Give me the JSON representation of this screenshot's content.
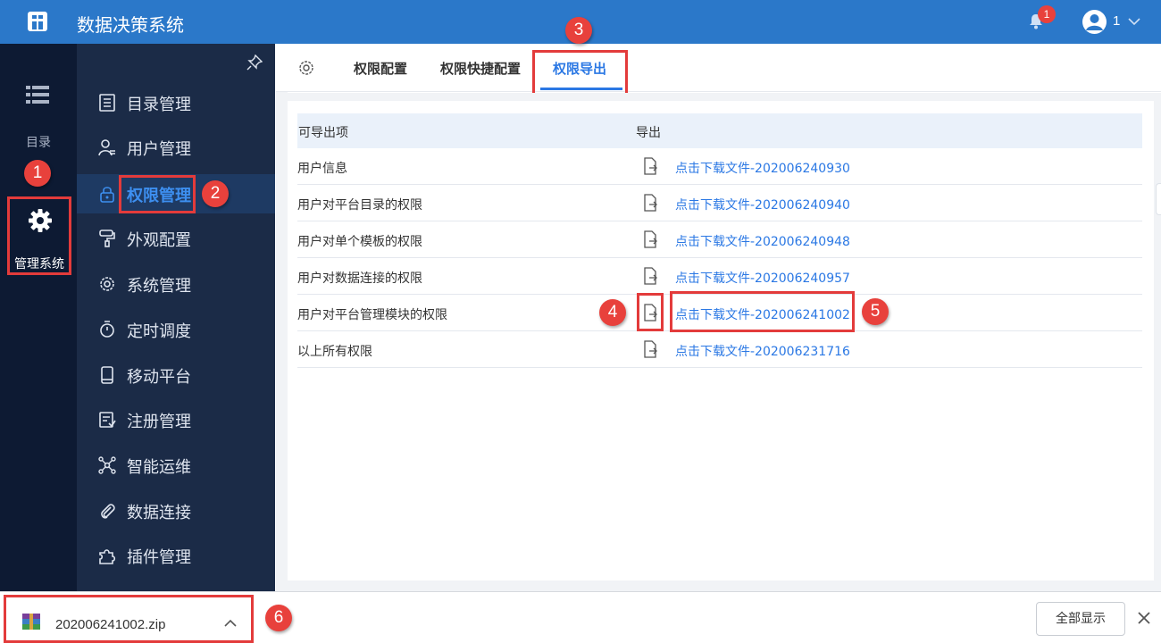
{
  "header": {
    "app_title": "数据决策系统",
    "notification_count": "1",
    "user_name": "1"
  },
  "rail": {
    "catalog_label": "目录",
    "manage_label": "管理系统"
  },
  "sidebar": {
    "items": [
      {
        "label": "目录管理",
        "icon": "list-doc-icon"
      },
      {
        "label": "用户管理",
        "icon": "user-icon"
      },
      {
        "label": "权限管理",
        "icon": "lock-icon",
        "active": true
      },
      {
        "label": "外观配置",
        "icon": "paint-roller-icon"
      },
      {
        "label": "系统管理",
        "icon": "gear-icon"
      },
      {
        "label": "定时调度",
        "icon": "timer-icon"
      },
      {
        "label": "移动平台",
        "icon": "mobile-icon"
      },
      {
        "label": "注册管理",
        "icon": "register-icon"
      },
      {
        "label": "智能运维",
        "icon": "network-icon"
      },
      {
        "label": "数据连接",
        "icon": "paperclip-icon"
      },
      {
        "label": "插件管理",
        "icon": "puzzle-icon"
      }
    ]
  },
  "tabs": [
    {
      "label": "权限配置"
    },
    {
      "label": "权限快捷配置"
    },
    {
      "label": "权限导出",
      "active": true
    }
  ],
  "table": {
    "headers": {
      "item": "可导出项",
      "export": "导出"
    },
    "rows": [
      {
        "name": "用户信息",
        "link": "点击下载文件-202006240930"
      },
      {
        "name": "用户对平台目录的权限",
        "link": "点击下载文件-202006240940"
      },
      {
        "name": "用户对单个模板的权限",
        "link": "点击下载文件-202006240948"
      },
      {
        "name": "用户对数据连接的权限",
        "link": "点击下载文件-202006240957"
      },
      {
        "name": "用户对平台管理模块的权限",
        "link": "点击下载文件-202006241002"
      },
      {
        "name": "以上所有权限",
        "link": "点击下载文件-202006231716"
      }
    ]
  },
  "download_bar": {
    "file_name": "202006241002.zip",
    "show_all": "全部显示"
  },
  "callouts": [
    "1",
    "2",
    "3",
    "4",
    "5",
    "6"
  ],
  "colors": {
    "header_bg": "#2b78c9",
    "rail_bg": "#0d1a33",
    "sidebar_bg": "#1b2b47",
    "accent": "#2b78e4",
    "highlight": "#e33b3b"
  }
}
